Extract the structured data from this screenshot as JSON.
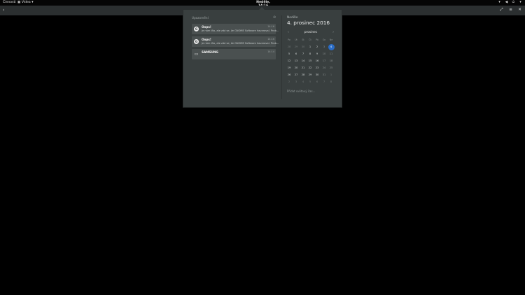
{
  "topbar": {
    "activities": "Činnosti",
    "app_menu": "Videa",
    "clock": "Neděle, 14:16",
    "tray_icons": [
      "network-icon",
      "volume-icon",
      "power-icon",
      "settings-icon"
    ]
  },
  "headerbar": {
    "back_icon": "back-arrow-icon",
    "buttons": [
      "fullscreen-icon",
      "menu-icon",
      "close-icon"
    ]
  },
  "notifications": {
    "heading": "Upozornění",
    "items": [
      {
        "title": "Oops!",
        "body": "Je nám líto, ale zdá se, že GNOME Software havaroval. Prob...",
        "time": "14:16",
        "icon": "gnome-software-icon",
        "icon_text": "G"
      },
      {
        "title": "Oops!",
        "body": "Je nám líto, ale zdá se, že GNOME Software havaroval. Prob...",
        "time": "14:16",
        "icon": "gnome-software-icon",
        "icon_text": "G"
      },
      {
        "title": "SAMSUNG",
        "body": "",
        "time": "14:14",
        "icon": "drive-icon",
        "icon_text": "▭"
      }
    ]
  },
  "calendar": {
    "weekday": "Neděle",
    "date": "4. prosinec 2016",
    "month": "prosinec",
    "prev": "‹",
    "next": "›",
    "weekday_headers": [
      "Po",
      "Út",
      "St",
      "Čt",
      "Pá",
      "So",
      "Ne"
    ],
    "weeks": [
      [
        "28",
        "29",
        "30",
        "1",
        "2",
        "3",
        "4"
      ],
      [
        "5",
        "6",
        "7",
        "8",
        "9",
        "10",
        "11"
      ],
      [
        "12",
        "13",
        "14",
        "15",
        "16",
        "17",
        "18"
      ],
      [
        "19",
        "20",
        "21",
        "22",
        "23",
        "24",
        "25"
      ],
      [
        "26",
        "27",
        "28",
        "29",
        "30",
        "31",
        "1"
      ],
      [
        "2",
        "3",
        "4",
        "5",
        "6",
        "7",
        "8"
      ]
    ],
    "today": "4",
    "events_link": "Přidat světový čas..."
  },
  "colors": {
    "today_highlight": "#2a6cc6",
    "popup_bg": "#393f3f",
    "notification_bg": "#4a5050"
  }
}
